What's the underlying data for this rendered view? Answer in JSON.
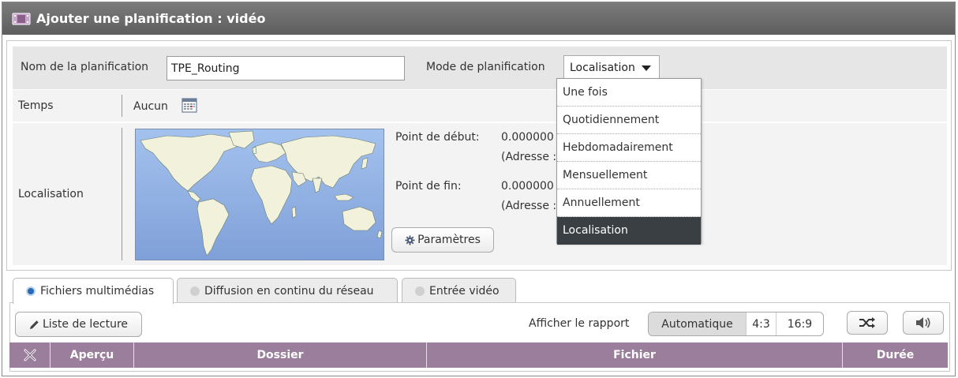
{
  "window": {
    "title": "Ajouter une planification : vidéo"
  },
  "form": {
    "name_label": "Nom de la planification",
    "name_value": "TPE_Routing",
    "mode_label": "Mode de planification",
    "mode_value": "Localisation",
    "mode_options": [
      "Une fois",
      "Quotidiennement",
      "Hebdomadairement",
      "Mensuellement",
      "Annuellement",
      "Localisation"
    ],
    "mode_selected_index": 5,
    "time_label": "Temps",
    "time_value": "Aucun",
    "location_label": "Localisation",
    "start_label": "Point de début:",
    "start_value": "0.000000 ,",
    "start_address": "(Adresse :",
    "end_label": "Point de fin:",
    "end_value": "0.000000 ,",
    "end_address": "(Adresse :",
    "params_button": "Paramètres"
  },
  "tabs": [
    {
      "label": "Fichiers multimédias",
      "active": true
    },
    {
      "label": "Diffusion en continu du réseau",
      "active": false
    },
    {
      "label": "Entrée vidéo",
      "active": false
    }
  ],
  "toolbar": {
    "playlist_button": "Liste de lecture",
    "ratio_label": "Afficher le rapport",
    "ratio_options": [
      "Automatique",
      "4:3",
      "16:9"
    ],
    "ratio_selected": "Automatique"
  },
  "table": {
    "headers": [
      "Aperçu",
      "Dossier",
      "Fichier",
      "Durée"
    ]
  },
  "colors": {
    "title_bar": "#666666",
    "table_header": "#9a7e9c",
    "dropdown_selected": "#3a3f44",
    "map_ocean": "#8fb1e5",
    "map_land": "#f2f2dc"
  }
}
